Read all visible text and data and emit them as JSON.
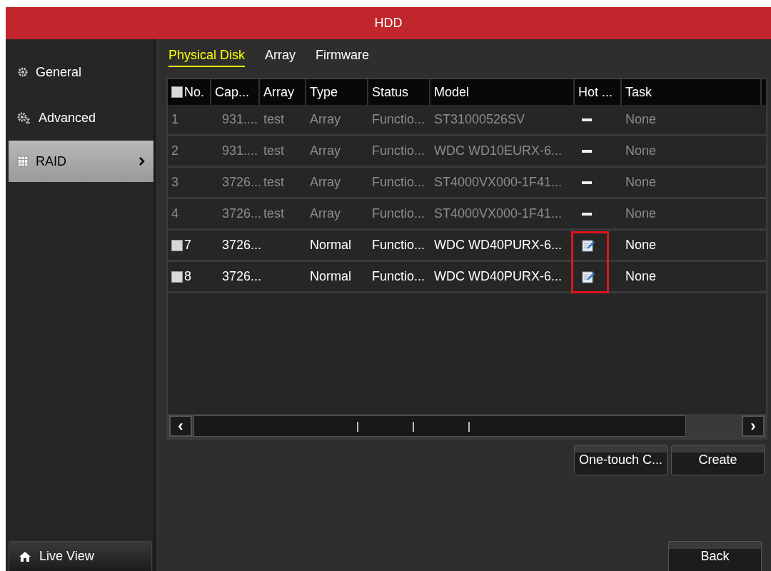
{
  "window": {
    "title": "HDD"
  },
  "sidebar": {
    "items": [
      {
        "label": "General",
        "kind": "gear",
        "selected": false
      },
      {
        "label": "Advanced",
        "kind": "gear2",
        "selected": false
      },
      {
        "label": "RAID",
        "kind": "grid",
        "selected": true
      }
    ],
    "live_view": "Live View"
  },
  "tabs": [
    {
      "label": "Physical Disk",
      "selected": true
    },
    {
      "label": "Array",
      "selected": false
    },
    {
      "label": "Firmware",
      "selected": false
    }
  ],
  "table": {
    "header_checkbox": {
      "checked": false
    },
    "columns": [
      "No.",
      "Cap...",
      "Array",
      "Type",
      "Status",
      "Model",
      "Hot ...",
      "Task"
    ],
    "rows": [
      {
        "no": "1",
        "capacity": "931....",
        "array": "test",
        "type": "Array",
        "status": "Functio...",
        "model": "ST31000526SV",
        "hot_spare": {
          "kind": "dash",
          "highlighted": false
        },
        "task": "None",
        "disabled": true
      },
      {
        "no": "2",
        "capacity": "931....",
        "array": "test",
        "type": "Array",
        "status": "Functio...",
        "model": "WDC WD10EURX-6...",
        "hot_spare": {
          "kind": "dash",
          "highlighted": false
        },
        "task": "None",
        "disabled": true
      },
      {
        "no": "3",
        "capacity": "3726...",
        "array": "test",
        "type": "Array",
        "status": "Functio...",
        "model": "ST4000VX000-1F41...",
        "hot_spare": {
          "kind": "dash",
          "highlighted": false
        },
        "task": "None",
        "disabled": true
      },
      {
        "no": "4",
        "capacity": "3726...",
        "array": "test",
        "type": "Array",
        "status": "Functio...",
        "model": "ST4000VX000-1F41...",
        "hot_spare": {
          "kind": "dash",
          "highlighted": false
        },
        "task": "None",
        "disabled": true
      },
      {
        "no": "7",
        "checkbox": {
          "checked": false
        },
        "capacity": "3726...",
        "type": "Normal",
        "status": "Functio...",
        "model": "WDC WD40PURX-6...",
        "hot_spare": {
          "kind": "edit",
          "highlighted": true
        },
        "task": "None",
        "disabled": false
      },
      {
        "no": "8",
        "checkbox": {
          "checked": false
        },
        "capacity": "3726...",
        "type": "Normal",
        "status": "Functio...",
        "model": "WDC WD40PURX-6...",
        "hot_spare": {
          "kind": "edit",
          "highlighted": true
        },
        "task": "None",
        "disabled": false
      }
    ]
  },
  "scrollbar": {
    "left": "‹",
    "right": "›"
  },
  "buttons": [
    "One-touch C...",
    "Create"
  ],
  "back": "Back"
}
